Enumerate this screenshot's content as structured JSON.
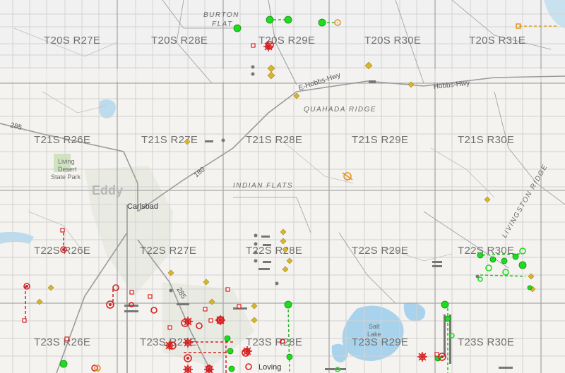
{
  "map": {
    "township_labels": [
      {
        "id": "t20s-r27e",
        "text": "T20S R27E"
      },
      {
        "id": "t20s-r28e",
        "text": "T20S R28E"
      },
      {
        "id": "t20s-r29e",
        "text": "T20S R29E"
      },
      {
        "id": "t20s-r30e",
        "text": "T20S R30E"
      },
      {
        "id": "t20s-r31e",
        "text": "T20S R31E"
      },
      {
        "id": "t21s-r26e",
        "text": "T21S R26E"
      },
      {
        "id": "t21s-r27e",
        "text": "T21S R27E"
      },
      {
        "id": "t21s-r28e",
        "text": "T21S R28E"
      },
      {
        "id": "t21s-r29e",
        "text": "T21S R29E"
      },
      {
        "id": "t21s-r30e",
        "text": "T21S R30E"
      },
      {
        "id": "t22s-r26e",
        "text": "T22S R26E"
      },
      {
        "id": "t22s-r27e",
        "text": "T22S R27E"
      },
      {
        "id": "t22s-r28e",
        "text": "T22S R28E"
      },
      {
        "id": "t22s-r29e",
        "text": "T22S R29E"
      },
      {
        "id": "t22s-r30e",
        "text": "T22S R30E"
      },
      {
        "id": "t23s-r26e",
        "text": "T23S R26E"
      },
      {
        "id": "t23s-r27e",
        "text": "T23S R27E"
      },
      {
        "id": "t23s-r28e",
        "text": "T23S R28E"
      },
      {
        "id": "t23s-r29e",
        "text": "T23S R29E"
      },
      {
        "id": "t23s-r30e",
        "text": "T23S R30E"
      }
    ],
    "places": {
      "burton_flat_1": "BURTON",
      "burton_flat_2": "FLAT",
      "quahada_ridge": "QUAHADA RIDGE",
      "indian_flats": "INDIAN FLATS",
      "livingston_ridge": "LIVINGSTON RIDGE",
      "park_1": "Living",
      "park_2": "Desert",
      "park_3": "State Park",
      "lake_1": "Salt",
      "lake_2": "Lake"
    },
    "roads": {
      "e_hobbs": "E-Hobbs-Hwy",
      "hobbs": "Hobbs-Hwy",
      "r285": "285",
      "r180": "180",
      "r285b": "285"
    },
    "county": "Eddy",
    "city": "Carlsbad",
    "city_bottom": "Loving",
    "colors": {
      "active_gas": "#ff0000",
      "active_oil": "#00dd00",
      "permitted": "#e8a317",
      "plugged": "#555555",
      "location": "#d4b32a",
      "grid": "#c9c9c9",
      "road": "#999999",
      "water": "#a9d3ec",
      "park": "#cfe3bf"
    }
  }
}
